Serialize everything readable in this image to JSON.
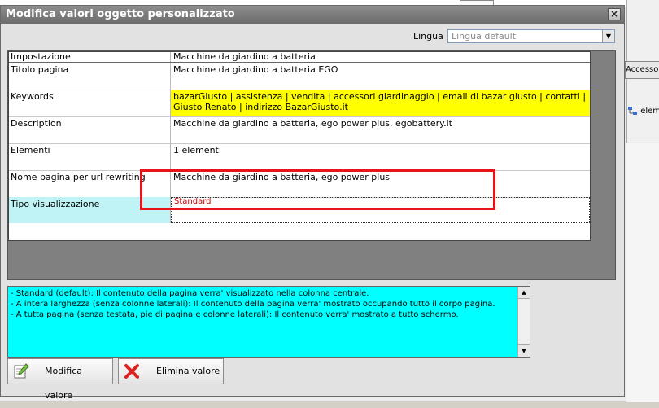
{
  "window": {
    "title": "Modifica valori oggetto personalizzato",
    "close_label": "×"
  },
  "language": {
    "label": "Lingua :",
    "value": "Lingua default"
  },
  "grid": {
    "header": [
      "Impostazione",
      "Macchine da giardino a batteria"
    ],
    "rows": [
      {
        "name": "Titolo pagina",
        "value": "Macchine da giardino a batteria EGO"
      },
      {
        "name": "Keywords",
        "value": "bazarGiusto | assistenza | vendita | accessori giardinaggio | email di bazar giusto | contatti | Giusto Renato | indirizzo BazarGiusto.it"
      },
      {
        "name": "Description",
        "value": "Macchine da giardino a batteria, ego power plus, egobattery.it"
      },
      {
        "name": "Elementi",
        "value": "1 elementi"
      },
      {
        "name": "Nome pagina per url rewriting",
        "value": "Macchine da giardino a batteria, ego power plus"
      },
      {
        "name": "Tipo visualizzazione",
        "value": "Standard"
      }
    ]
  },
  "description_text": [
    "- Standard (default): Il contenuto della pagina verra' visualizzato nella colonna centrale.",
    "- A intera larghezza (senza colonne laterali): Il contenuto della pagina verra' mostrato occupando tutto il corpo pagina.",
    "- A tutta pagina (senza testata, pie di pagina e colonne laterali): Il contenuto verra' mostrato a tutto schermo."
  ],
  "buttons": {
    "modifica": "Modifica valore",
    "elimina": "Elimina valore"
  },
  "background": {
    "right_tab": "Accessor",
    "right_item": "elem"
  },
  "colors": {
    "keywords_highlight": "#ffff00",
    "description_bg": "#00ffff",
    "selected_cell": "#bff3f6",
    "annotation_box": "#e8141a"
  }
}
